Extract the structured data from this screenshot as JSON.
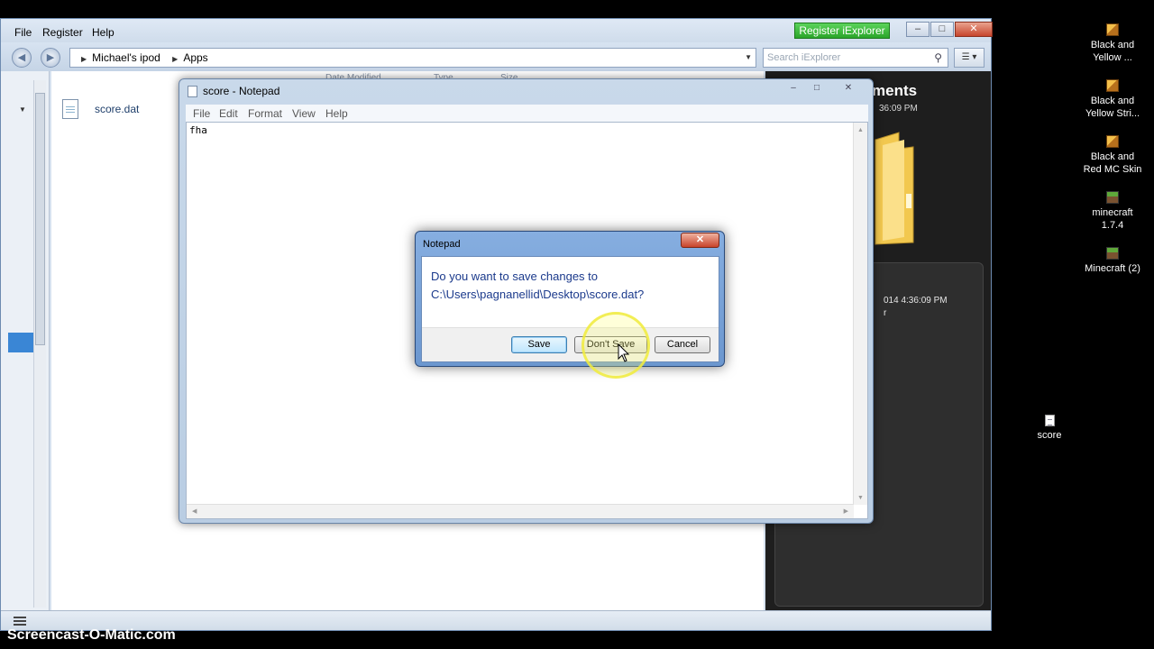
{
  "desktop": {
    "icons": [
      {
        "label": "Black and\nYellow ...",
        "icon": "minecraft-skin-icon"
      },
      {
        "label": "Black and\nYellow Stri...",
        "icon": "minecraft-skin-icon"
      },
      {
        "label": "Black and\nRed MC Skin",
        "icon": "minecraft-skin-icon"
      },
      {
        "label": "minecraft\n1.7.4",
        "icon": "minecraft-grass-icon"
      },
      {
        "label": "Minecraft (2)",
        "icon": "minecraft-grass-icon"
      },
      {
        "label": "score",
        "icon": "text-file-icon"
      }
    ]
  },
  "iexplorer": {
    "menu": [
      "File",
      "Register",
      "Help"
    ],
    "register_button": "Register iExplorer",
    "breadcrumb": [
      "Michael's ipod",
      "Apps"
    ],
    "search_placeholder": "Search iExplorer",
    "file": {
      "name": "score.dat"
    },
    "columns": [
      "Date Modified",
      "Type",
      "Size"
    ],
    "right_panel": {
      "title": "ments",
      "subtitle": "36:09 PM",
      "date": "014 4:36:09 PM",
      "extra": "r"
    }
  },
  "notepad": {
    "title": "score - Notepad",
    "menu": [
      "File",
      "Edit",
      "Format",
      "View",
      "Help"
    ],
    "content": "fha"
  },
  "dialog": {
    "title": "Notepad",
    "message_line1": "Do you want to save changes to",
    "message_line2": "C:\\Users\\pagnanellid\\Desktop\\score.dat?",
    "buttons": {
      "save": "Save",
      "dont_save": "Don't Save",
      "cancel": "Cancel"
    }
  },
  "watermark": "Screencast-O-Matic.com"
}
